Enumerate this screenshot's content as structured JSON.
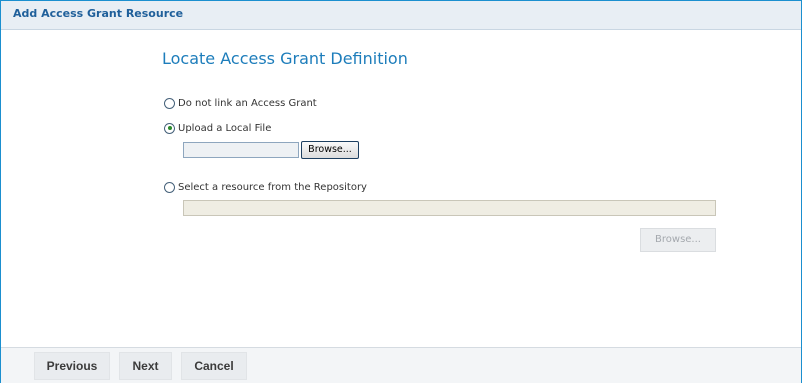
{
  "window": {
    "title": "Add Access Grant Resource"
  },
  "main": {
    "heading": "Locate Access Grant Definition",
    "options": {
      "no_link": {
        "label": "Do not link an Access Grant",
        "selected": false
      },
      "upload_local": {
        "label": "Upload a Local File",
        "selected": true
      },
      "select_repo": {
        "label": "Select a resource from the Repository",
        "selected": false
      }
    },
    "upload_browse_label": "Browse...",
    "upload_file_value": "",
    "repo_path_value": "",
    "repo_browse_label": "Browse..."
  },
  "footer": {
    "previous_label": "Previous",
    "next_label": "Next",
    "cancel_label": "Cancel"
  },
  "colors": {
    "border_accent": "#1b8fcf",
    "title_text": "#1f5f9a",
    "heading_text": "#1d7dbb",
    "radio_checked": "#2a8a2a",
    "disabled_text": "#a5a9ae"
  }
}
